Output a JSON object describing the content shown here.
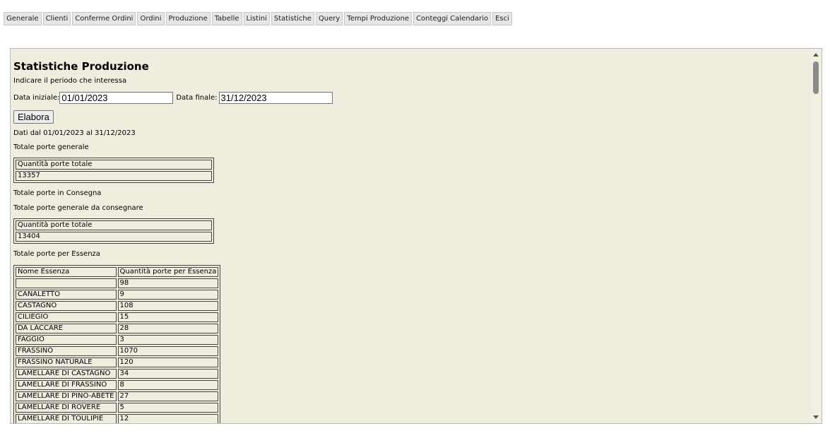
{
  "tabs": [
    "Generale",
    "Clienti",
    "Conferme Ordini",
    "Ordini",
    "Produzione",
    "Tabelle",
    "Listini",
    "Statistiche",
    "Query",
    "Tempi Produzione",
    "Conteggi Calendario",
    "Esci"
  ],
  "page": {
    "title": "Statistiche Produzione",
    "instruction": "Indicare il periodo che interessa",
    "start_label": "Data iniziale:",
    "start_value": "01/01/2023",
    "end_label": "Data finale:",
    "end_value": "31/12/2023",
    "button": "Elabora",
    "period": "Dati dal 01/01/2023 al 31/12/2023"
  },
  "sections": {
    "general_heading": "Totale porte generale",
    "general_header": "Quantità porte totale",
    "general_value": "13357",
    "delivery_heading": "Totale porte in Consegna",
    "todeliver_heading": "Totale porte generale da consegnare",
    "todeliver_header": "Quantità porte totale",
    "todeliver_value": "13404",
    "essence_heading": "Totale porte per Essenza"
  },
  "essence_table": {
    "headers": [
      "Nome Essenza",
      "Quantità porte per Essenza"
    ],
    "rows": [
      [
        "",
        "98"
      ],
      [
        "CANALETTO",
        "9"
      ],
      [
        "CASTAGNO",
        "108"
      ],
      [
        "CILIEGIO",
        "15"
      ],
      [
        "DA LACCARE",
        "28"
      ],
      [
        "FAGGIO",
        "3"
      ],
      [
        "FRASSINO",
        "1070"
      ],
      [
        "FRASSINO NATURALE",
        "120"
      ],
      [
        "LAMELLARE DI CASTAGNO",
        "34"
      ],
      [
        "LAMELLARE DI FRASSINO",
        "8"
      ],
      [
        "LAMELLARE DI PINO-ABETE",
        "27"
      ],
      [
        "LAMELLARE DI ROVERE",
        "5"
      ],
      [
        "LAMELLARE DI TOULIPIE",
        "12"
      ]
    ]
  }
}
